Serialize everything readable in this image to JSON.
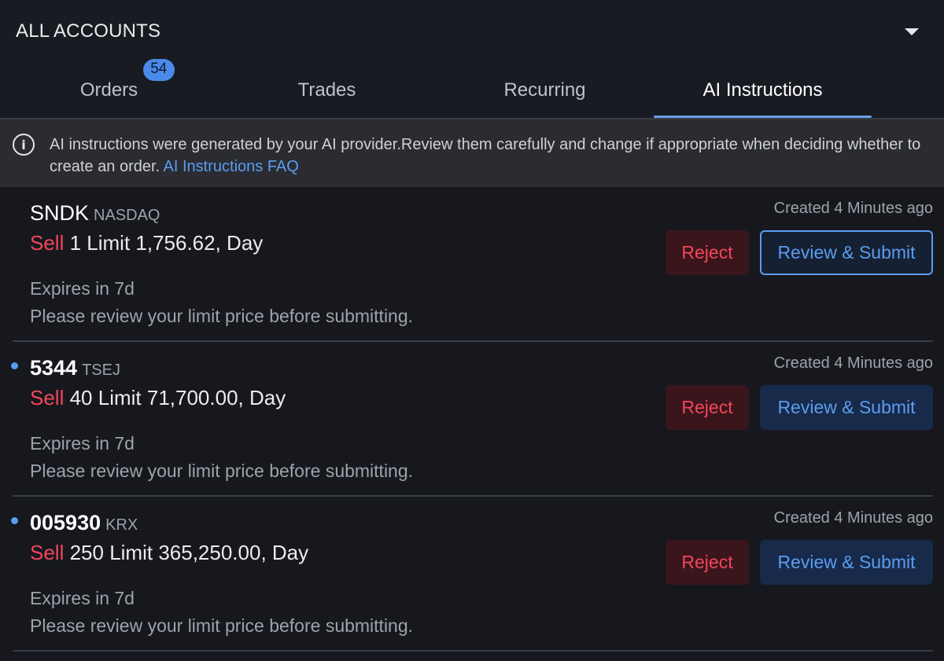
{
  "header": {
    "account_selector": "ALL ACCOUNTS"
  },
  "tabs": [
    {
      "label": "Orders",
      "badge": "54"
    },
    {
      "label": "Trades"
    },
    {
      "label": "Recurring"
    },
    {
      "label": "AI Instructions",
      "active": true
    }
  ],
  "banner": {
    "text": "AI instructions were generated by your AI provider.Review them carefully and change if appropriate when deciding whether to create an order.",
    "link": "AI Instructions FAQ"
  },
  "orders": [
    {
      "symbol": "SNDK",
      "exchange": "NASDAQ",
      "side": "Sell",
      "details": "1 Limit 1,756.62, Day",
      "created": "Created 4 Minutes ago",
      "expires": "Expires in 7d",
      "note": "Please review your limit price before submitting.",
      "reject_label": "Reject",
      "review_label": "Review & Submit"
    },
    {
      "symbol": "5344",
      "exchange": "TSEJ",
      "side": "Sell",
      "details": "40 Limit 71,700.00, Day",
      "created": "Created 4 Minutes ago",
      "expires": "Expires in 7d",
      "note": "Please review your limit price before submitting.",
      "reject_label": "Reject",
      "review_label": "Review & Submit"
    },
    {
      "symbol": "005930",
      "exchange": "KRX",
      "side": "Sell",
      "details": "250 Limit 365,250.00, Day",
      "created": "Created 4 Minutes ago",
      "expires": "Expires in 7d",
      "note": "Please review your limit price before submitting.",
      "reject_label": "Reject",
      "review_label": "Review & Submit"
    }
  ],
  "colors": {
    "accent": "#5b9cf0",
    "sell": "#f2465a",
    "background": "#16181e"
  }
}
